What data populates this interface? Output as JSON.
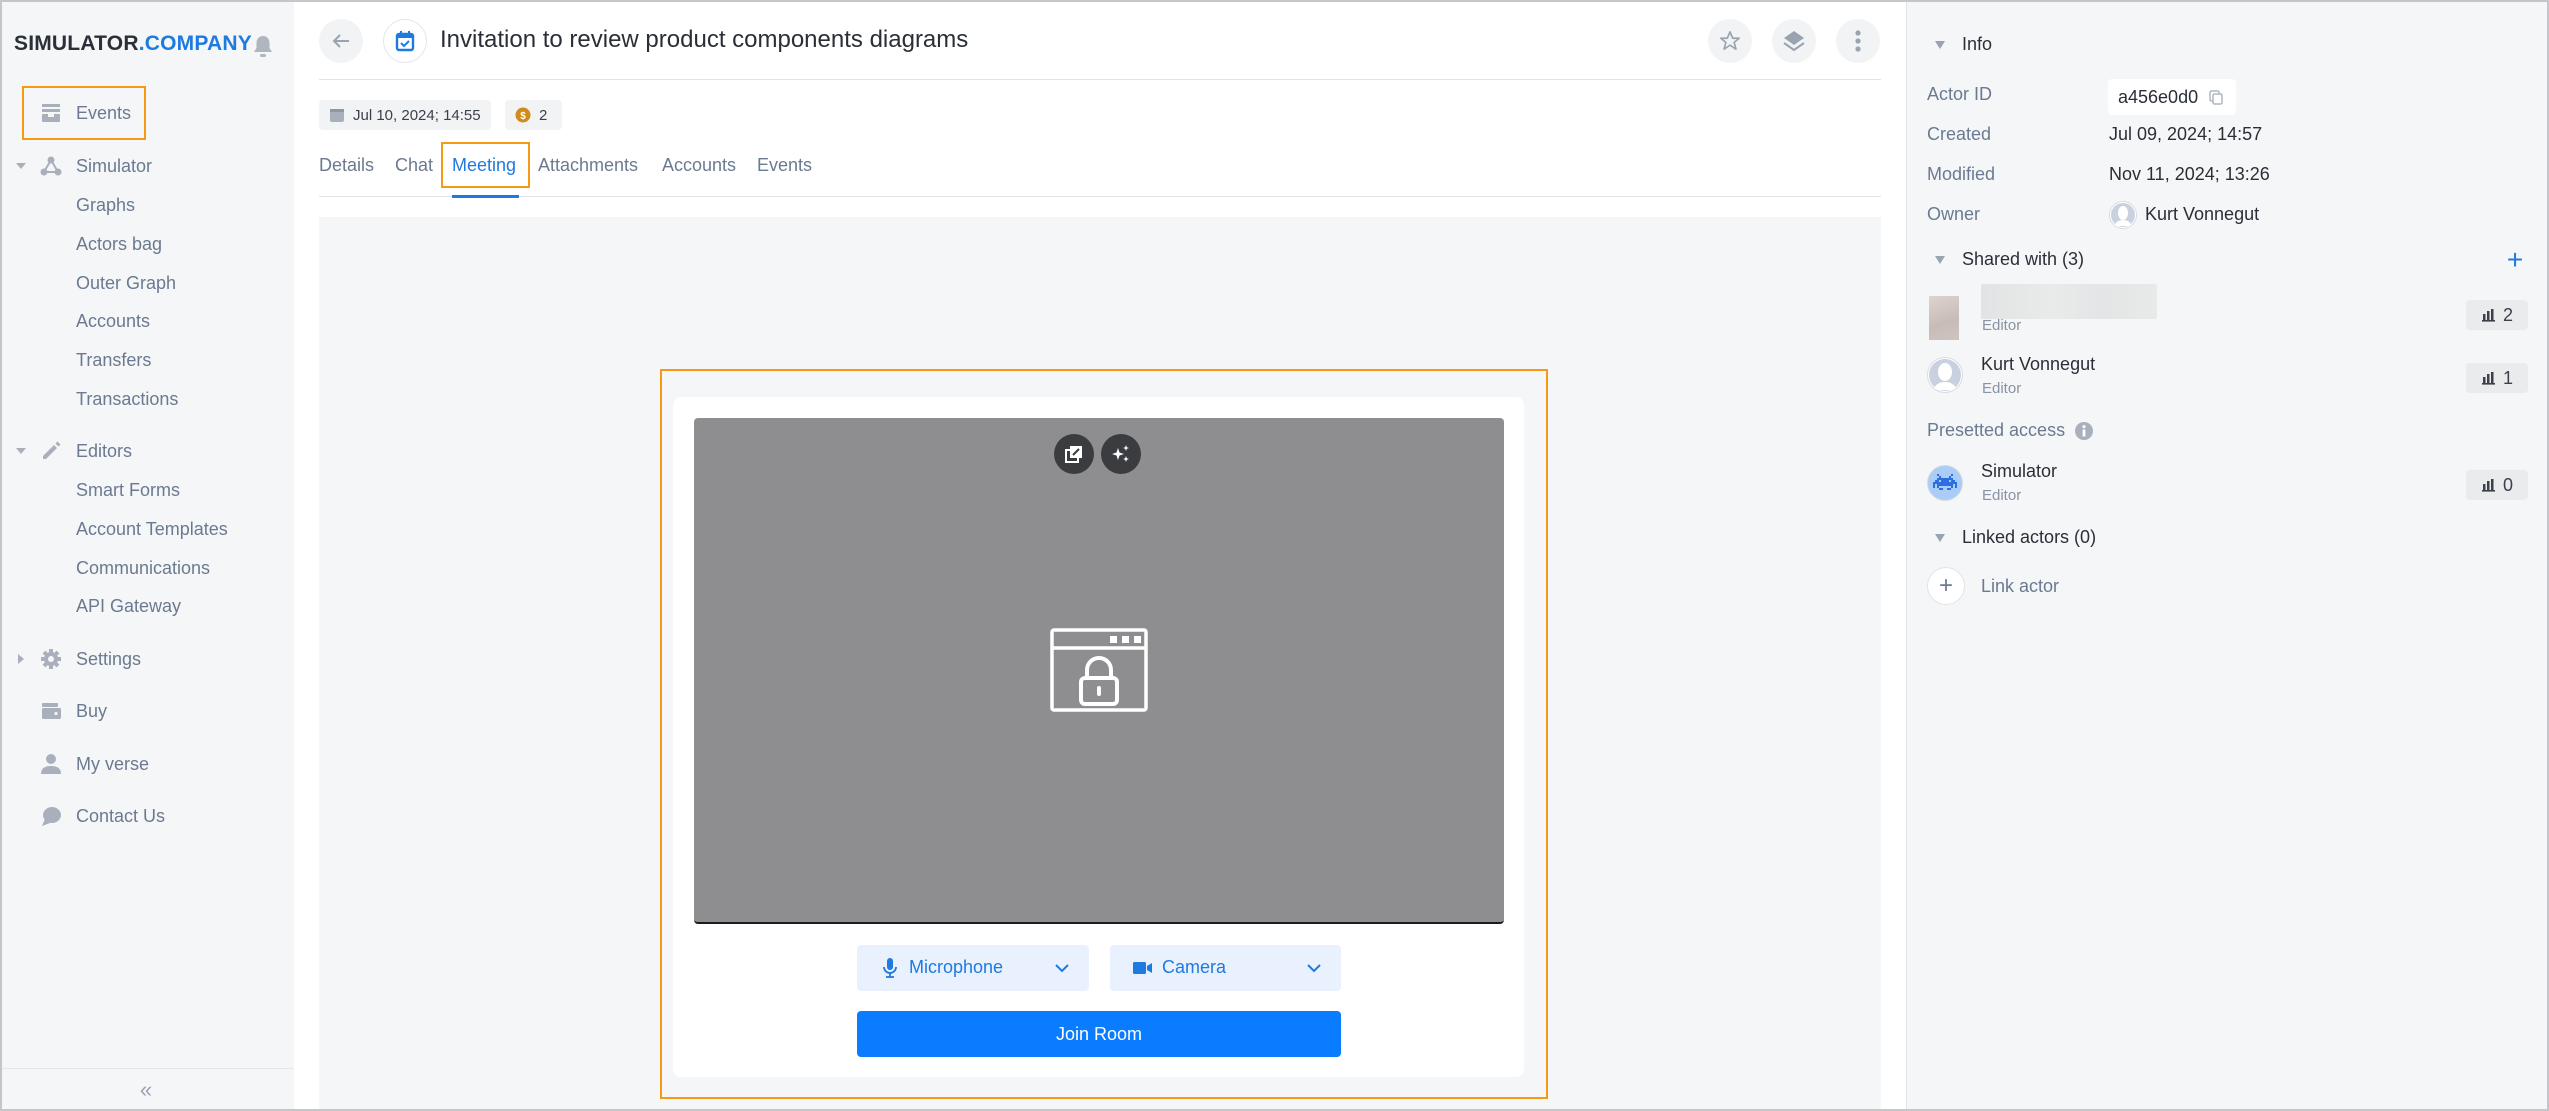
{
  "app": {
    "logo_part1": "SIMULATOR",
    "logo_part2": ".COMPANY",
    "brand_color": "#1f7ae0",
    "highlight_color": "#f59a12"
  },
  "sidebar": {
    "items": [
      {
        "label": "Events",
        "icon": "inbox-tray-icon",
        "highlighted": true
      },
      {
        "label": "Simulator",
        "icon": "graph-nodes-icon",
        "expandable": true,
        "expanded": true
      },
      {
        "label": "Graphs",
        "child": true
      },
      {
        "label": "Actors bag",
        "child": true
      },
      {
        "label": "Outer Graph",
        "child": true
      },
      {
        "label": "Accounts",
        "child": true
      },
      {
        "label": "Transfers",
        "child": true
      },
      {
        "label": "Transactions",
        "child": true
      },
      {
        "label": "Editors",
        "icon": "pencil-icon",
        "expandable": true,
        "expanded": true
      },
      {
        "label": "Smart Forms",
        "child": true
      },
      {
        "label": "Account Templates",
        "child": true
      },
      {
        "label": "Communications",
        "child": true
      },
      {
        "label": "API Gateway",
        "child": true
      },
      {
        "label": "Settings",
        "icon": "gear-icon",
        "expandable": true,
        "expanded": false
      },
      {
        "label": "Buy",
        "icon": "wallet-icon"
      },
      {
        "label": "My verse",
        "icon": "user-icon"
      },
      {
        "label": "Contact Us",
        "icon": "chat-bubble-icon"
      }
    ],
    "collapse_icon": "«"
  },
  "header": {
    "title": "Invitation to review product components diagrams",
    "date_chip": "Jul 10, 2024; 14:55",
    "coin_count": "2",
    "coin_symbol": "$"
  },
  "tabs": [
    {
      "label": "Details",
      "active": false
    },
    {
      "label": "Chat",
      "active": false
    },
    {
      "label": "Meeting",
      "active": true
    },
    {
      "label": "Attachments",
      "active": false
    },
    {
      "label": "Accounts",
      "active": false
    },
    {
      "label": "Events",
      "active": false
    }
  ],
  "meeting": {
    "microphone_label": "Microphone",
    "camera_label": "Camera",
    "join_label": "Join Room"
  },
  "info": {
    "section_title": "Info",
    "actor_id_label": "Actor ID",
    "actor_id": "a456e0d0",
    "created_label": "Created",
    "created": "Jul 09, 2024; 14:57",
    "modified_label": "Modified",
    "modified": "Nov 11, 2024; 13:26",
    "owner_label": "Owner",
    "owner": "Kurt Vonnegut"
  },
  "shared": {
    "title": "Shared with (3)",
    "people": [
      {
        "name": "",
        "role": "Editor",
        "count": "2",
        "blurred": true
      },
      {
        "name": "Kurt Vonnegut",
        "role": "Editor",
        "count": "1"
      }
    ],
    "presetted_label": "Presetted access",
    "presetted": [
      {
        "name": "Simulator",
        "role": "Editor",
        "count": "0"
      }
    ]
  },
  "linked": {
    "title": "Linked actors (0)",
    "link_label": "Link actor"
  }
}
